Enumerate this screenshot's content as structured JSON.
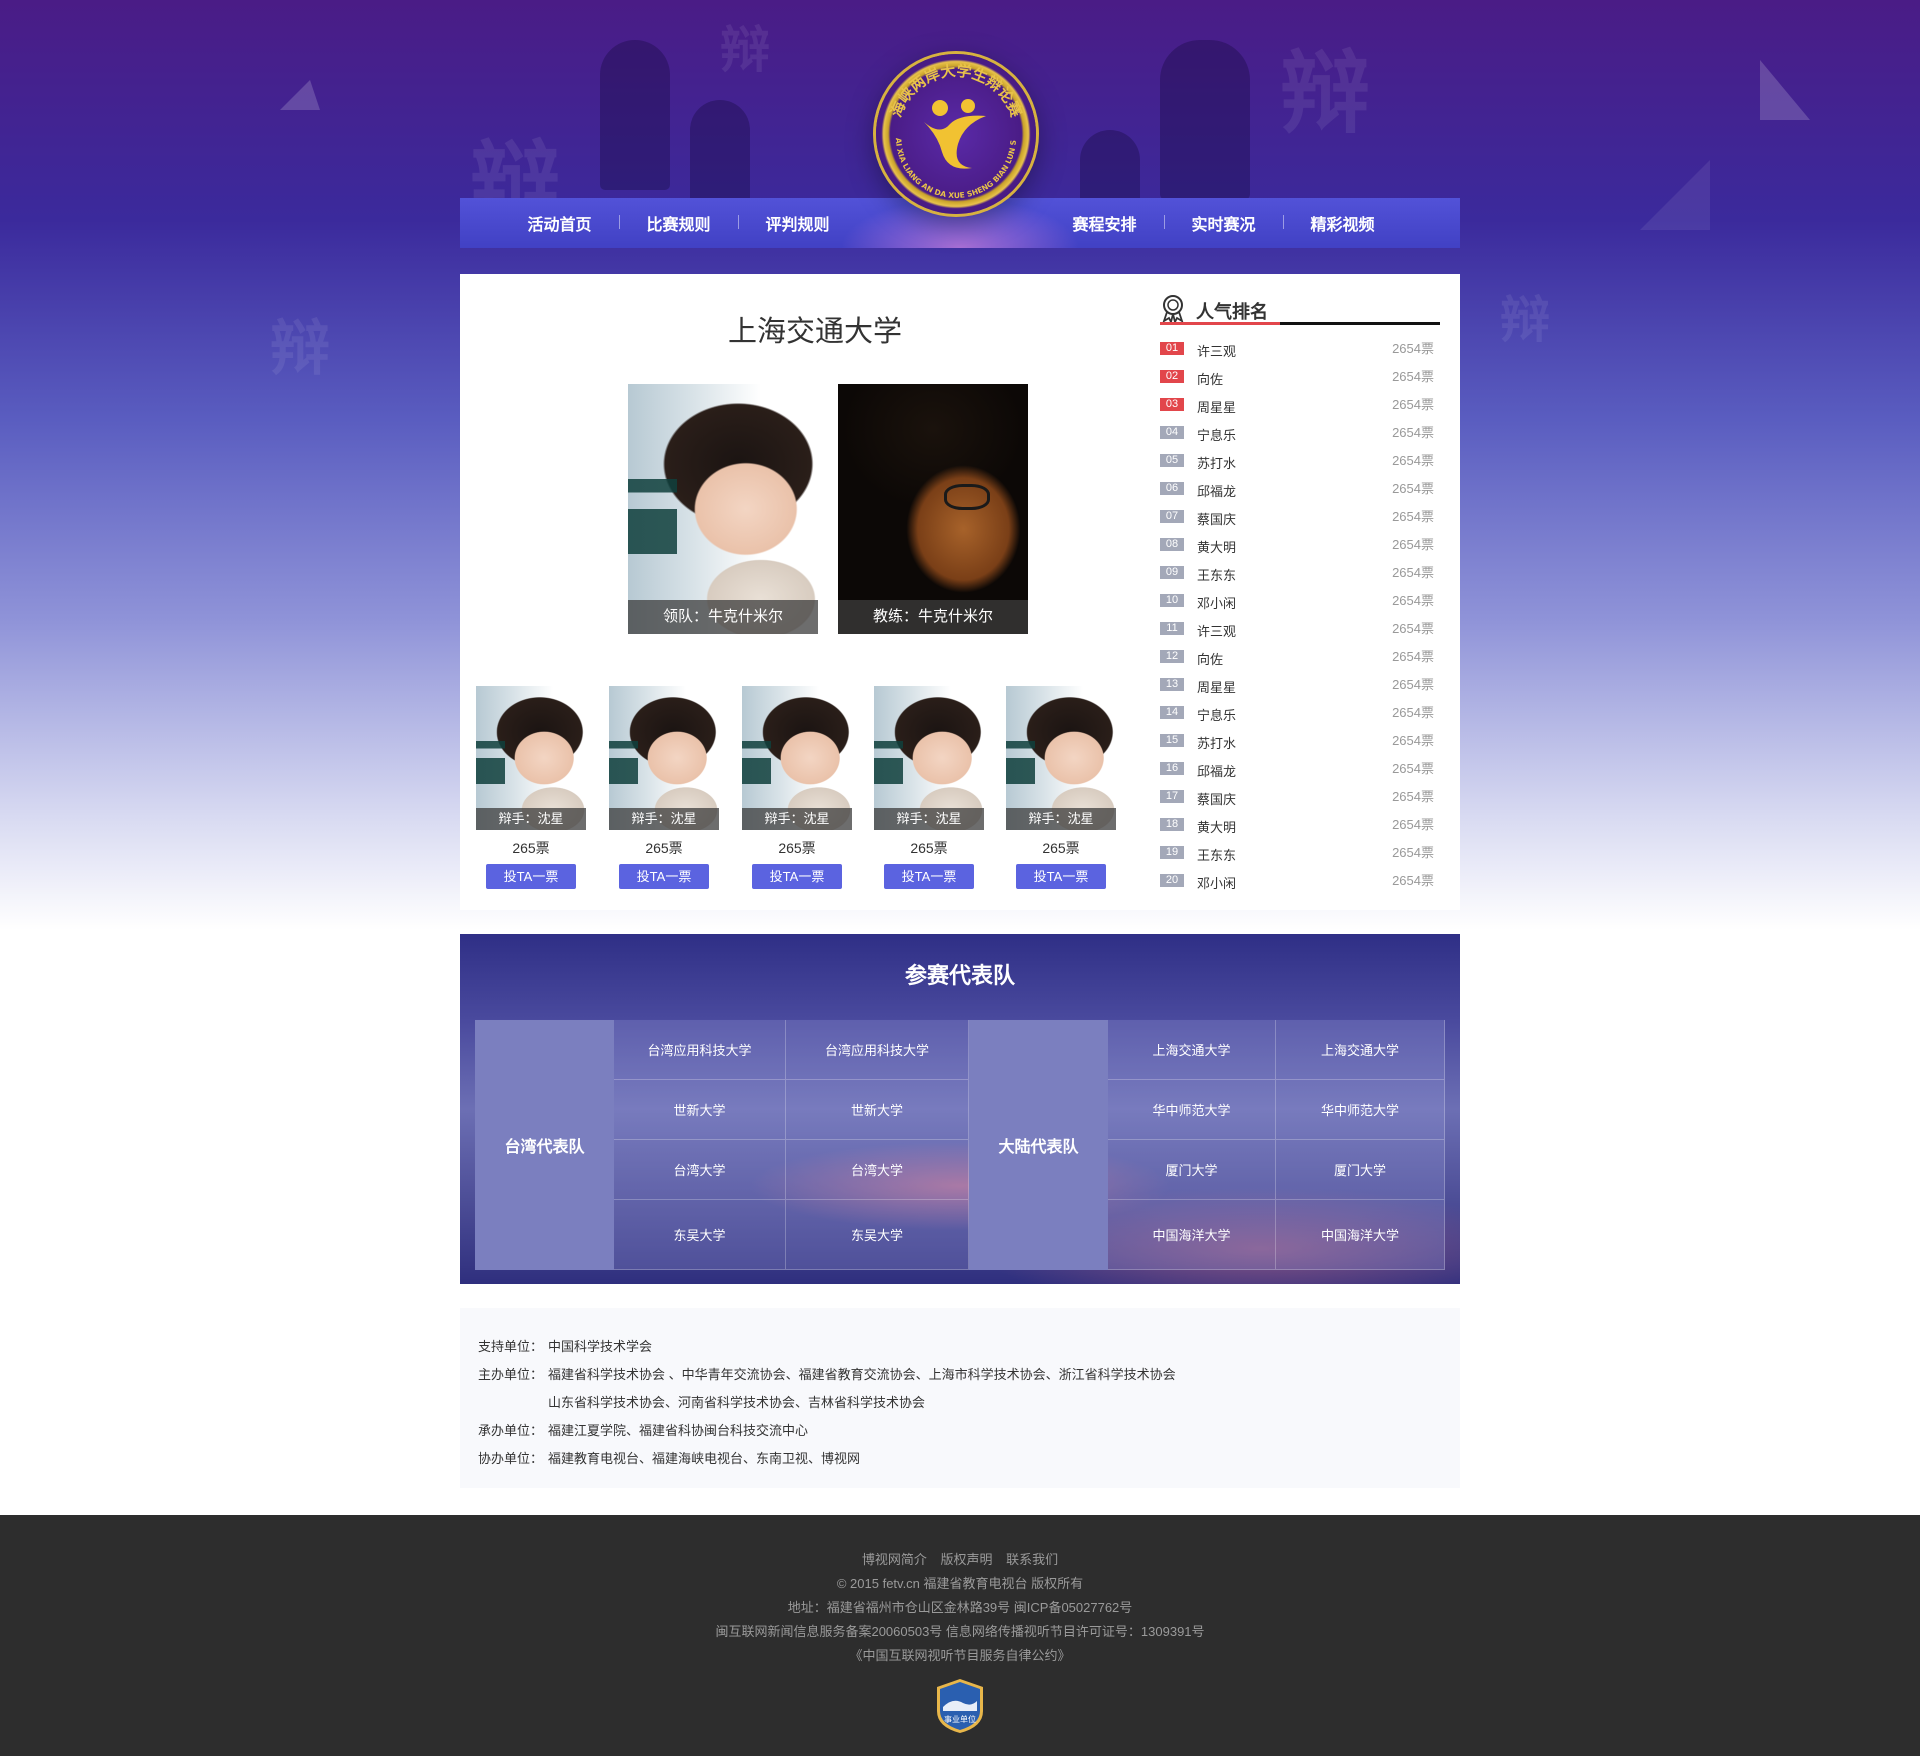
{
  "header": {
    "logo_text_cn": "海峡两岸大学生辩论赛",
    "logo_text_pinyin": "HAI XIA LIANG AN DA XUE SHENG BIAN LUN SAI",
    "nav_left": [
      "活动首页",
      "比赛规则",
      "评判规则"
    ],
    "nav_right": [
      "赛程安排",
      "实时赛况",
      "精彩视频"
    ]
  },
  "main": {
    "university": "上海交通大学",
    "leader_caption": "领队：牛克什米尔",
    "coach_caption": "教练：牛克什米尔",
    "debaters": [
      {
        "caption": "辩手：沈星",
        "votes": "265票",
        "button": "投TA一票"
      },
      {
        "caption": "辩手：沈星",
        "votes": "265票",
        "button": "投TA一票"
      },
      {
        "caption": "辩手：沈星",
        "votes": "265票",
        "button": "投TA一票"
      },
      {
        "caption": "辩手：沈星",
        "votes": "265票",
        "button": "投TA一票"
      },
      {
        "caption": "辩手：沈星",
        "votes": "265票",
        "button": "投TA一票"
      }
    ]
  },
  "ranking": {
    "title": "人气排名",
    "items": [
      {
        "num": "01",
        "name": "许三观",
        "votes": "2654票"
      },
      {
        "num": "02",
        "name": "向佐",
        "votes": "2654票"
      },
      {
        "num": "03",
        "name": "周星星",
        "votes": "2654票"
      },
      {
        "num": "04",
        "name": "宁息乐",
        "votes": "2654票"
      },
      {
        "num": "05",
        "name": "苏打水",
        "votes": "2654票"
      },
      {
        "num": "06",
        "name": "邱福龙",
        "votes": "2654票"
      },
      {
        "num": "07",
        "name": "蔡国庆",
        "votes": "2654票"
      },
      {
        "num": "08",
        "name": "黄大明",
        "votes": "2654票"
      },
      {
        "num": "09",
        "name": "王东东",
        "votes": "2654票"
      },
      {
        "num": "10",
        "name": "邓小闲",
        "votes": "2654票"
      },
      {
        "num": "11",
        "name": "许三观",
        "votes": "2654票"
      },
      {
        "num": "12",
        "name": "向佐",
        "votes": "2654票"
      },
      {
        "num": "13",
        "name": "周星星",
        "votes": "2654票"
      },
      {
        "num": "14",
        "name": "宁息乐",
        "votes": "2654票"
      },
      {
        "num": "15",
        "name": "苏打水",
        "votes": "2654票"
      },
      {
        "num": "16",
        "name": "邱福龙",
        "votes": "2654票"
      },
      {
        "num": "17",
        "name": "蔡国庆",
        "votes": "2654票"
      },
      {
        "num": "18",
        "name": "黄大明",
        "votes": "2654票"
      },
      {
        "num": "19",
        "name": "王东东",
        "votes": "2654票"
      },
      {
        "num": "20",
        "name": "邓小闲",
        "votes": "2654票"
      }
    ]
  },
  "teams": {
    "title": "参赛代表队",
    "taiwan_label": "台湾代表队",
    "mainland_label": "大陆代表队",
    "taiwan_rows": [
      [
        "台湾应用科技大学",
        "台湾应用科技大学"
      ],
      [
        "世新大学",
        "世新大学"
      ],
      [
        "台湾大学",
        "台湾大学"
      ],
      [
        "东吴大学",
        "东吴大学"
      ]
    ],
    "mainland_rows": [
      [
        "上海交通大学",
        "上海交通大学"
      ],
      [
        "华中师范大学",
        "华中师范大学"
      ],
      [
        "厦门大学",
        "厦门大学"
      ],
      [
        "中国海洋大学",
        "中国海洋大学"
      ]
    ]
  },
  "sponsors": {
    "support_key": "支持单位：",
    "support_val": "中国科学技术学会",
    "host_key": "主办单位：",
    "host_val_1": "福建省科学技术协会 、中华青年交流协会、福建省教育交流协会、上海市科学技术协会、浙江省科学技术协会",
    "host_val_2": "山东省科学技术协会、河南省科学技术协会、吉林省科学技术协会",
    "organizer_key": "承办单位：",
    "organizer_val": "福建江夏学院、福建省科协闽台科技交流中心",
    "assist_key": "协办单位：",
    "assist_val": "福建教育电视台、福建海峡电视台、东南卫视、博视网"
  },
  "footer": {
    "links": [
      "博视网简介",
      "版权声明",
      "联系我们"
    ],
    "copyright": "© 2015 fetv.cn 福建省教育电视台 版权所有",
    "address": "地址：福建省福州市仓山区金林路39号 闽ICP备05027762号",
    "license": "闽互联网新闻信息服务备案20060503号 信息网络传播视听节目许可证号：1309391号",
    "pledge": "《中国互联网视听节目服务自律公约》",
    "badge_text": "事业单位"
  },
  "colors": {
    "nav_bg": "#4a4ad0",
    "rank_red": "#e2464b",
    "vote_button": "#5b63e0",
    "footer_bg": "#2d2d2d"
  }
}
